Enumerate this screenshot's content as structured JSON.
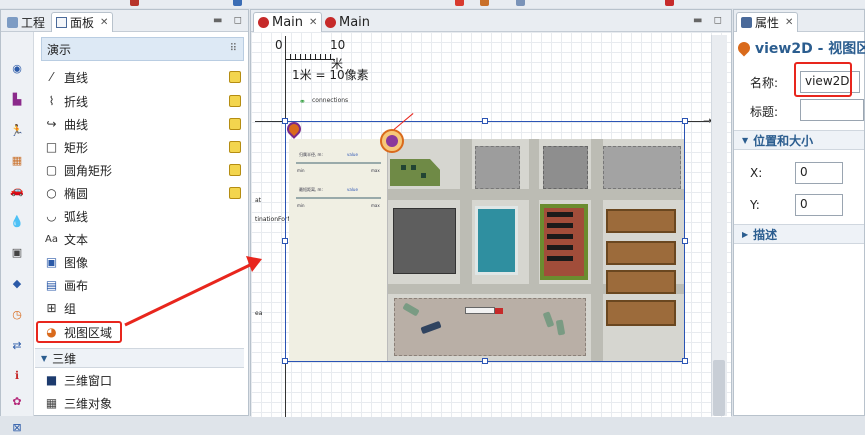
{
  "left_panel": {
    "tabs": [
      "工程",
      "面板"
    ],
    "header": "演示",
    "items": [
      {
        "label": "直线",
        "icon": "line-icon"
      },
      {
        "label": "折线",
        "icon": "polyline-icon"
      },
      {
        "label": "曲线",
        "icon": "curve-icon"
      },
      {
        "label": "矩形",
        "icon": "rectangle-icon"
      },
      {
        "label": "圆角矩形",
        "icon": "rounded-rectangle-icon"
      },
      {
        "label": "椭圆",
        "icon": "oval-icon"
      },
      {
        "label": "弧线",
        "icon": "arc-icon"
      },
      {
        "label": "文本",
        "icon": "text-icon"
      },
      {
        "label": "图像",
        "icon": "image-icon"
      },
      {
        "label": "画布",
        "icon": "canvas-icon"
      },
      {
        "label": "组",
        "icon": "group-icon"
      },
      {
        "label": "视图区域",
        "icon": "view-area-icon"
      }
    ],
    "section_3d": "三维",
    "items_3d": [
      {
        "label": "三维窗口",
        "icon": "window-3d-icon"
      },
      {
        "label": "三维对象",
        "icon": "object-3d-icon"
      }
    ]
  },
  "editor": {
    "tabs": [
      "Main",
      "Main"
    ],
    "scale": {
      "start": "0",
      "end": "10",
      "unit": "米",
      "caption": "1米 = 10像素"
    },
    "connections_label": "connections",
    "left_labels": [
      "at",
      "tinationForMe",
      "ea"
    ],
    "controls": [
      {
        "label": "归属半径, m:",
        "value_label": "value",
        "min": "min",
        "max": "max"
      },
      {
        "label": "最短距离, m:",
        "value_label": "value",
        "min": "min",
        "max": "max"
      }
    ]
  },
  "properties": {
    "tab": "属性",
    "title": "view2D - 视图区",
    "name_label": "名称:",
    "name_value": "view2D",
    "caption_label": "标题:",
    "caption_value": "",
    "section_position": "位置和大小",
    "x_label": "X:",
    "x_value": "0",
    "y_label": "Y:",
    "y_value": "0",
    "section_desc": "描述"
  },
  "colors": {
    "highlight": "#e8261d",
    "selection": "#2b54b4",
    "panel_header": "#dde9f5",
    "title_blue": "#2b5d8f"
  }
}
